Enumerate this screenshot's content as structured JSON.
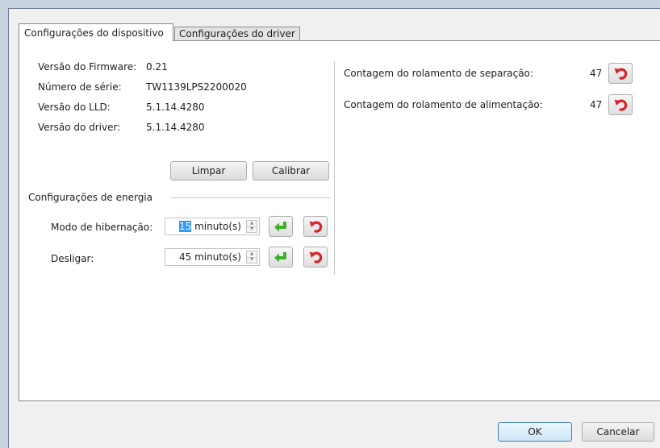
{
  "tabs": [
    {
      "label": "Configurações do dispositivo",
      "active": true
    },
    {
      "label": "Configurações do driver",
      "active": false
    }
  ],
  "device_info": {
    "firmware_label": "Versão do Firmware:",
    "firmware_value": "0.21",
    "serial_label": "Número de série:",
    "serial_value": "TW1139LPS2200020",
    "lld_label": "Versão do LLD:",
    "lld_value": "5.1.14.4280",
    "driver_label": "Versão do driver:",
    "driver_value": "5.1.14.4280"
  },
  "actions": {
    "clear_label": "Limpar",
    "calibrate_label": "Calibrar"
  },
  "power": {
    "group_label": "Configurações de energia",
    "hibernate_label": "Modo de hibernação:",
    "hibernate_value": "15",
    "hibernate_unit": "minuto(s)",
    "off_label": "Desligar:",
    "off_value": "45",
    "off_unit": "minuto(s)"
  },
  "rollers": {
    "separation_label": "Contagem do rolamento de separação:",
    "separation_count": "47",
    "feed_label": "Contagem do rolamento de alimentação:",
    "feed_count": "47"
  },
  "footer": {
    "ok_label": "OK",
    "cancel_label": "Cancelar"
  },
  "icons": {
    "apply": "green-enter-arrow-icon",
    "reset": "red-undo-arrow-icon"
  },
  "colors": {
    "apply_green": "#3fae29",
    "reset_red": "#d8232a",
    "selection_blue": "#3399ff"
  }
}
